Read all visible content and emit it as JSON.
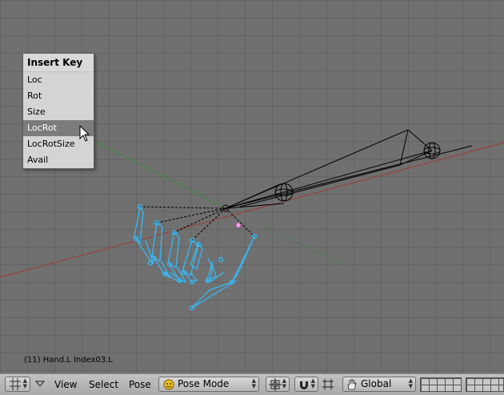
{
  "popup_menu": {
    "title": "Insert Key",
    "items": [
      "Loc",
      "Rot",
      "Size",
      "LocRot",
      "LocRotSize",
      "Avail"
    ],
    "active_index": 3
  },
  "viewport": {
    "status_text": "(11) Hand.L Index03.L",
    "grid_color": "#5a5a5a",
    "x_axis_color": "#9e3b3b",
    "y_axis_color": "#3e8a3e",
    "selected_bone_color": "#36b9f5"
  },
  "header": {
    "menus": [
      "View",
      "Select",
      "Pose"
    ],
    "mode": "Pose Mode",
    "orientation": "Global",
    "icons": [
      "viewport-type-icon",
      "menu-collapse-icon",
      "pose-mode-icon",
      "pivot-icon",
      "snap-magnet-icon",
      "manipulator-hand-icon",
      "layers-icon"
    ]
  }
}
